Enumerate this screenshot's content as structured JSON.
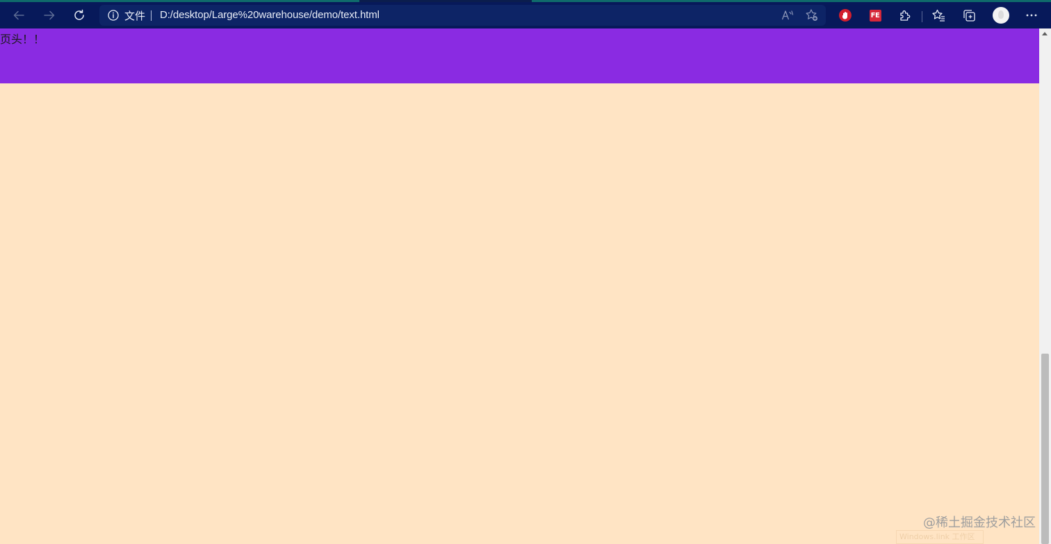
{
  "browser": {
    "address_bar": {
      "file_label": "文件",
      "url": "D:/desktop/Large%20warehouse/demo/text.html"
    },
    "icons": {
      "back": "back-arrow-icon",
      "forward": "forward-arrow-icon",
      "refresh": "refresh-icon",
      "info": "info-icon",
      "read_aloud": "read-aloud-icon",
      "add_favorite": "add-favorite-icon",
      "adblock_extension": "adblock-extension-icon",
      "fe_extension": "fe-extension-icon",
      "fe_extension_label": "FE",
      "extensions": "puzzle-icon",
      "favorites": "favorites-icon",
      "collections": "collections-icon",
      "profile": "profile-avatar",
      "more": "more-menu-icon"
    },
    "colors": {
      "toolbar_bg": "#07195a",
      "address_bg": "#0d2466"
    }
  },
  "page": {
    "header_text": "页头！！",
    "colors": {
      "header_bg": "#8A2BE2",
      "body_bg": "#FFE4C4"
    }
  },
  "overlay": {
    "watermark": "@稀土掘金技术社区",
    "activation_text": "Windows.link 工作区"
  }
}
